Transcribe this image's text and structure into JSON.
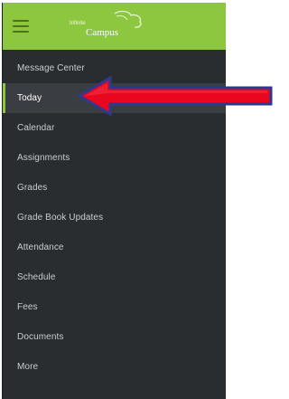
{
  "header": {
    "logo_text": "Campus",
    "logo_tagline": "Infinite"
  },
  "menu": {
    "items": [
      {
        "label": "Message Center"
      },
      {
        "label": "Today"
      },
      {
        "label": "Calendar"
      },
      {
        "label": "Assignments"
      },
      {
        "label": "Grades"
      },
      {
        "label": "Grade Book Updates"
      },
      {
        "label": "Attendance"
      },
      {
        "label": "Schedule"
      },
      {
        "label": "Fees"
      },
      {
        "label": "Documents"
      },
      {
        "label": "More"
      }
    ],
    "active_index": 1
  },
  "colors": {
    "topbar": "#8dc63f",
    "sidebar": "#2a2d30",
    "arrow_fill": "#e8071f",
    "arrow_outline": "#2b3a8f"
  }
}
